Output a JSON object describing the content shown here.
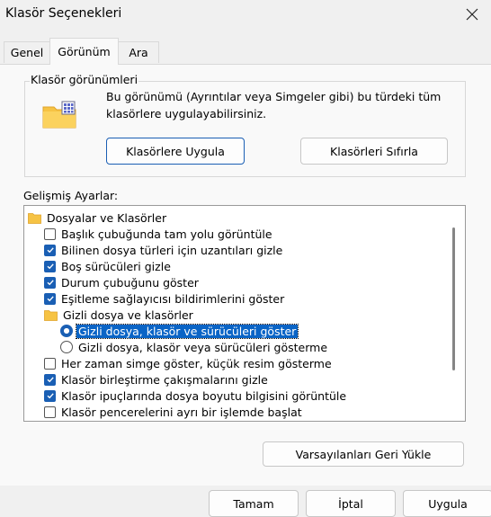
{
  "window": {
    "title": "Klasör Seçenekleri",
    "close_icon": "close-icon"
  },
  "tabs": [
    {
      "label": "Genel"
    },
    {
      "label": "Görünüm",
      "active": true
    },
    {
      "label": "Ara"
    }
  ],
  "folder_views": {
    "legend": "Klasör görünümleri",
    "icon": "folder-grid-icon",
    "description": "Bu görünümü (Ayrıntılar veya Simgeler gibi) bu türdeki tüm klasörlere uygulayabilirsiniz.",
    "apply_button": "Klasörlere Uygula",
    "reset_button": "Klasörleri Sıfırla"
  },
  "advanced": {
    "label": "Gelişmiş Ayarlar:",
    "items": [
      {
        "type": "folder",
        "label": "Dosyalar ve Klasörler"
      },
      {
        "type": "checkbox",
        "label": "Başlık çubuğunda tam yolu görüntüle",
        "checked": false
      },
      {
        "type": "checkbox",
        "label": "Bilinen dosya türleri için uzantıları gizle",
        "checked": true
      },
      {
        "type": "checkbox",
        "label": "Boş sürücüleri gizle",
        "checked": true
      },
      {
        "type": "checkbox",
        "label": "Durum çubuğunu göster",
        "checked": true
      },
      {
        "type": "checkbox",
        "label": "Eşitleme sağlayıcısı bildirimlerini göster",
        "checked": true
      },
      {
        "type": "folder",
        "label": "Gizli dosya ve klasörler"
      },
      {
        "type": "radio",
        "label": "Gizli dosya, klasör ve sürücüleri göster",
        "selected": true
      },
      {
        "type": "radio",
        "label": "Gizli dosya, klasör veya sürücüleri gösterme",
        "selected": false
      },
      {
        "type": "checkbox",
        "label": "Her zaman simge göster, küçük resim gösterme",
        "checked": false
      },
      {
        "type": "checkbox",
        "label": "Klasör birleştirme çakışmalarını gizle",
        "checked": true
      },
      {
        "type": "checkbox",
        "label": "Klasör ipuçlarında dosya boyutu bilgisini görüntüle",
        "checked": true
      },
      {
        "type": "checkbox",
        "label": "Klasör pencerelerini ayrı bir işlemde başlat",
        "checked": false
      }
    ]
  },
  "defaults_button": "Varsayılanları Geri Yükle",
  "footer": {
    "ok": "Tamam",
    "cancel": "İptal",
    "apply": "Uygula"
  },
  "colors": {
    "accent": "#1a5fb4",
    "selection": "#0a64c6"
  }
}
